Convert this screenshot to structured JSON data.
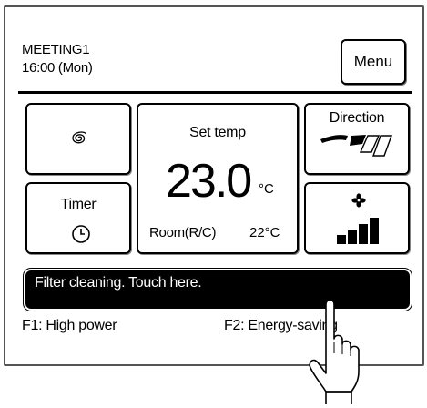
{
  "header": {
    "room_name": "MEETING1",
    "clock": "16:00 (Mon)",
    "menu_label": "Menu"
  },
  "tiles": {
    "mode_icon": "swirl-icon",
    "timer_label": "Timer",
    "timer_icon": "clock-icon",
    "direction_label": "Direction",
    "direction_icon": "louver-icon",
    "fan_icon": "fan-icon",
    "fan_speed_level": 4
  },
  "temperature": {
    "set_label": "Set temp",
    "value": "23.0",
    "unit": "°C",
    "room_label": "Room(R/C)",
    "room_value": "22°C"
  },
  "status": {
    "message": "Filter cleaning. Touch here."
  },
  "function_keys": {
    "f1": "F1: High power",
    "f2": "F2: Energy-saving"
  }
}
